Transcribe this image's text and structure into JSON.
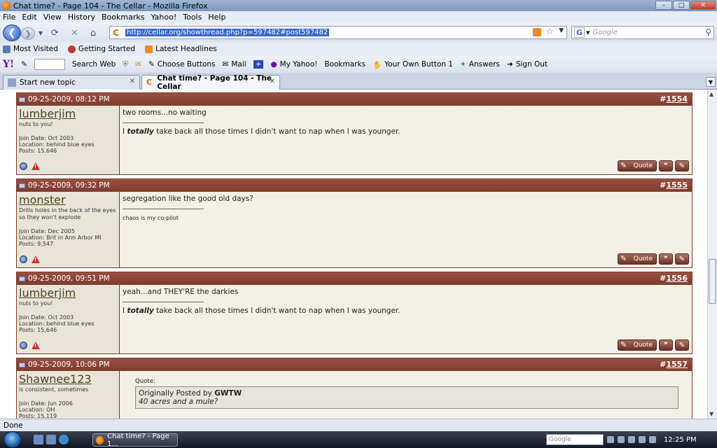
{
  "window": {
    "title": "Chat time? - Page 104 - The Cellar - Mozilla Firefox",
    "controls": [
      "–",
      "□",
      "✕"
    ]
  },
  "menu": [
    "File",
    "Edit",
    "View",
    "History",
    "Bookmarks",
    "Yahoo!",
    "Tools",
    "Help"
  ],
  "nav": {
    "url": "http://cellar.org/showthread.php?p=597482#post597482",
    "site_icon": "C",
    "search_placeholder": "Google",
    "search_engine": "G"
  },
  "bookmarks": [
    {
      "label": "Most Visited",
      "icon": "page-icon",
      "color": "#5b7bb8"
    },
    {
      "label": "Getting Started",
      "icon": "firefox-icon",
      "color": "#c0392b"
    },
    {
      "label": "Latest Headlines",
      "icon": "rss-icon",
      "color": "#4a6aa8"
    }
  ],
  "yahoo_toolbar": {
    "logo": "Y!",
    "items": [
      "Search Web",
      "Choose Buttons",
      "Mail",
      "My Yahoo!",
      "Bookmarks",
      "Your Own Button 1",
      "Answers",
      "Sign Out"
    ]
  },
  "tabs": [
    {
      "label": "Start new topic",
      "active": false
    },
    {
      "label": "Chat time? - Page 104 - The Cellar",
      "active": true
    }
  ],
  "posts": [
    {
      "date": "09-25-2009, 08:12 PM",
      "hash": "#",
      "number": "1554",
      "username": "lumberjim",
      "user_title": "nuts to you!",
      "join_date": "Join Date: Oct 2003",
      "location": "Location: behind blue eyes",
      "posts": "Posts: 15,646",
      "message": "two rooms...no waiting",
      "sig_prefix": "I ",
      "sig_bold": "totally",
      "sig_rest": " take back all those times I didn't want to nap when I was younger.",
      "quote_label": "Quote"
    },
    {
      "date": "09-25-2009, 09:32 PM",
      "hash": "#",
      "number": "1555",
      "username": "monster",
      "user_title": "Drills holes in the back of the eyes so they won't explode",
      "join_date": "Join Date: Dec 2005",
      "location": "Location: Brit in Ann Arbor MI",
      "posts": "Posts: 9,547",
      "message": "segregation like the good old days?",
      "sig_small": "chaos is my co-pilot",
      "quote_label": "Quote"
    },
    {
      "date": "09-25-2009, 09:51 PM",
      "hash": "#",
      "number": "1556",
      "username": "lumberjim",
      "user_title": "nuts to you!",
      "join_date": "Join Date: Oct 2003",
      "location": "Location: behind blue eyes",
      "posts": "Posts: 15,646",
      "message": "yeah...and THEY'RE the darkies",
      "sig_prefix": "I ",
      "sig_bold": "totally",
      "sig_rest": " take back all those times I didn't want to nap when I was younger.",
      "quote_label": "Quote"
    },
    {
      "date": "09-25-2009, 10:06 PM",
      "hash": "#",
      "number": "1557",
      "username": "Shawnee123",
      "user_title": "is consistent, sometimes",
      "join_date": "Join Date: Jun 2006",
      "location": "Location: OH",
      "posts": "Posts: 15,119",
      "quote_heading": "Quote:",
      "quoted_prefix": "Originally Posted by ",
      "quoted_author": "GWTW",
      "quoted_text": "40 acres and a mule?"
    }
  ],
  "status": "Done",
  "taskbar": {
    "window_button": "Chat time? - Page 1...",
    "tray_search": "Google",
    "clock": "12:25 PM"
  }
}
